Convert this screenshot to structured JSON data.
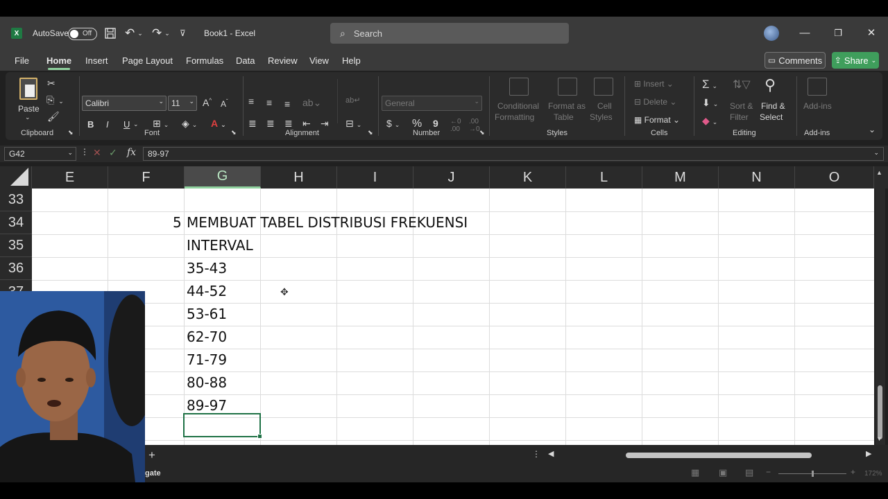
{
  "title_bar": {
    "app_icon": "excel-icon",
    "autosave_label": "AutoSave",
    "autosave_state": "Off",
    "doc_title": "Book1  -  Excel",
    "search_placeholder": "Search"
  },
  "menu": {
    "tabs": [
      "File",
      "Home",
      "Insert",
      "Page Layout",
      "Formulas",
      "Data",
      "Review",
      "View",
      "Help"
    ],
    "active_tab": "Home",
    "comments_label": "Comments",
    "share_label": "Share"
  },
  "ribbon": {
    "clipboard": {
      "paste_label": "Paste",
      "group_label": "Clipboard"
    },
    "font": {
      "font_name": "Calibri",
      "font_size": "11",
      "group_label": "Font",
      "bold": "B",
      "italic": "I",
      "underline": "U"
    },
    "alignment": {
      "group_label": "Alignment"
    },
    "number": {
      "format": "General",
      "group_label": "Number",
      "currency": "$",
      "percent": "%",
      "comma": "9"
    },
    "styles": {
      "conditional_line1": "Conditional",
      "conditional_line2": "Formatting",
      "format_table_line1": "Format as",
      "format_table_line2": "Table",
      "cell_styles_line1": "Cell",
      "cell_styles_line2": "Styles",
      "group_label": "Styles"
    },
    "cells": {
      "insert": "Insert",
      "delete": "Delete",
      "format": "Format",
      "group_label": "Cells"
    },
    "editing": {
      "sort_line1": "Sort &",
      "sort_line2": "Filter",
      "find_line1": "Find &",
      "find_line2": "Select",
      "group_label": "Editing"
    },
    "addins": {
      "label": "Add-ins",
      "group_label": "Add-ins"
    }
  },
  "formula_bar": {
    "name_box": "G42",
    "fx": "fx",
    "content": "89-97"
  },
  "grid": {
    "columns": [
      "E",
      "F",
      "G",
      "H",
      "I",
      "J",
      "K",
      "L",
      "M",
      "N",
      "O"
    ],
    "selected_column": "G",
    "rows": [
      "33",
      "34",
      "35",
      "36",
      "37"
    ],
    "cells": {
      "F34": "5",
      "G34": "MEMBUAT TABEL DISTRIBUSI FREKUENSI",
      "G35": "INTERVAL",
      "G36": "35-43",
      "G37": "44-52",
      "G38": "53-61",
      "G39": "62-70",
      "G40": "71-79",
      "G41": "80-88",
      "G42": "89-97"
    }
  },
  "status_bar": {
    "partial_text": "gate",
    "zoom": "172%"
  },
  "colors": {
    "accent_green": "#8fd19e",
    "share_green": "#3f9e5c",
    "selection_border": "#1e7145"
  }
}
